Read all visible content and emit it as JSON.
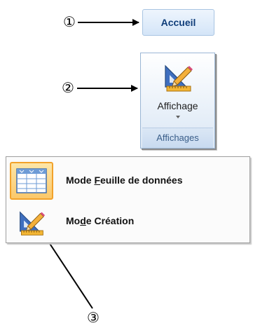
{
  "callouts": {
    "one": "①",
    "two": "②",
    "three": "③"
  },
  "ribbon": {
    "home_tab": "Accueil",
    "view_button_label": "Affichage",
    "group_label": "Affichages"
  },
  "menu": {
    "items": [
      {
        "prefix": "Mode ",
        "underlined": "F",
        "suffix": "euille de données",
        "icon": "datasheet-grid-icon",
        "selected": true
      },
      {
        "prefix": "Mo",
        "underlined": "d",
        "suffix": "e Création",
        "icon": "design-view-icon",
        "selected": false
      }
    ]
  },
  "colors": {
    "tab_text": "#0f3d7a",
    "selected_border": "#f2a22b",
    "selected_fill": "#fbc86a"
  }
}
